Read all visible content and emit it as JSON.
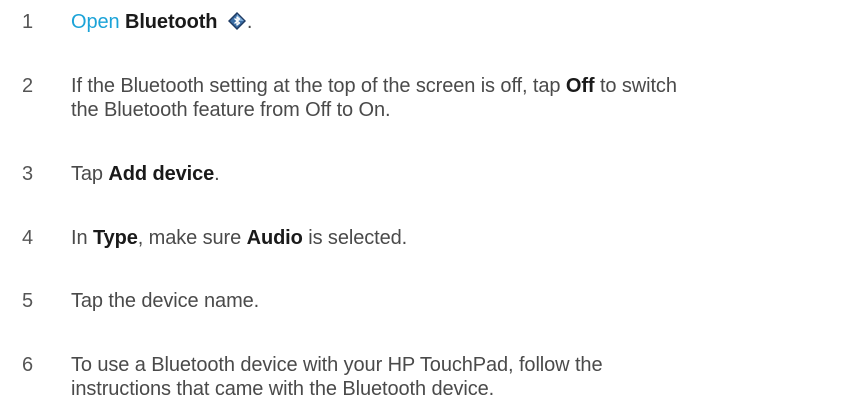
{
  "steps": [
    {
      "number": "1",
      "link_text": "Open",
      "bold_text": "Bluetooth",
      "tail": ".",
      "icon": "bluetooth-icon"
    },
    {
      "number": "2",
      "part1": "If the Bluetooth setting at the top of the screen is off, tap",
      "bold_text": "Off",
      "part2": "to switch",
      "line2": "the Bluetooth feature from Off to On."
    },
    {
      "number": "3",
      "part1": "Tap",
      "bold_text": "Add device",
      "tail": "."
    },
    {
      "number": "4",
      "part1": "In",
      "bold_text": "Type",
      "part2": ", make sure",
      "bold_text2": "Audio",
      "part3": "is selected."
    },
    {
      "number": "5",
      "text": "Tap the device name."
    },
    {
      "number": "6",
      "line1": "To use a Bluetooth device with your HP TouchPad, follow the",
      "line2": "instructions that came with the Bluetooth device."
    }
  ],
  "colors": {
    "link": "#1ba3d8",
    "text": "#4a4a4a",
    "bold": "#1a1a1a",
    "icon_dark": "#1f3b63",
    "icon_light": "#6fa8dc"
  }
}
